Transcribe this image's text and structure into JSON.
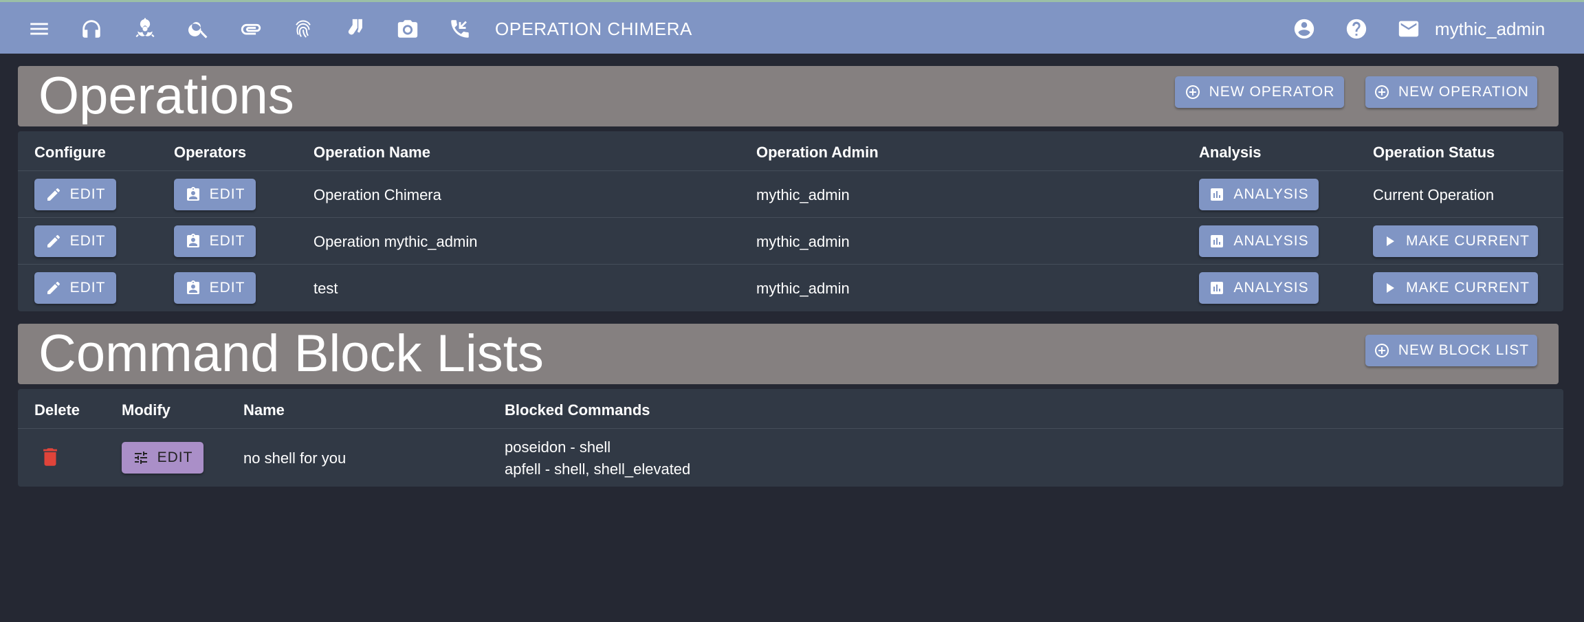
{
  "topbar": {
    "title": "OPERATION CHIMERA",
    "username": "mythic_admin",
    "nav_icons": [
      "menu-icon",
      "headphones-icon",
      "biohazard-icon",
      "search-icon",
      "paperclip-icon",
      "fingerprint-icon",
      "socks-icon",
      "camera-icon",
      "phone-callback-icon"
    ],
    "right_icons": [
      "account-circle-icon",
      "help-icon",
      "mail-icon"
    ]
  },
  "operations": {
    "title": "Operations",
    "new_operator_label": "NEW OPERATOR",
    "new_operation_label": "NEW OPERATION",
    "headers": [
      "Configure",
      "Operators",
      "Operation Name",
      "Operation Admin",
      "Analysis",
      "Operation Status"
    ],
    "rows": [
      {
        "configure_label": "EDIT",
        "operators_label": "EDIT",
        "name": "Operation Chimera",
        "admin": "mythic_admin",
        "analysis_label": "ANALYSIS",
        "status": "Current Operation"
      },
      {
        "configure_label": "EDIT",
        "operators_label": "EDIT",
        "name": "Operation mythic_admin",
        "admin": "mythic_admin",
        "analysis_label": "ANALYSIS",
        "status": "MAKE CURRENT"
      },
      {
        "configure_label": "EDIT",
        "operators_label": "EDIT",
        "name": "test",
        "admin": "mythic_admin",
        "analysis_label": "ANALYSIS",
        "status": "MAKE CURRENT"
      }
    ]
  },
  "block_lists": {
    "title": "Command Block Lists",
    "new_block_list_label": "NEW BLOCK LIST",
    "headers": [
      "Delete",
      "Modify",
      "Name",
      "Blocked Commands"
    ],
    "rows": [
      {
        "modify_label": "EDIT",
        "name": "no shell for you",
        "blocked": [
          "poseidon - shell",
          "apfell - shell, shell_elevated"
        ]
      }
    ]
  },
  "colors": {
    "topbar": "#8095c4",
    "background": "#252833",
    "section_header": "#858080",
    "table": "#313945",
    "button": "#8095c4",
    "edit_block_button": "#aa8fc8",
    "delete": "#e0443a"
  }
}
